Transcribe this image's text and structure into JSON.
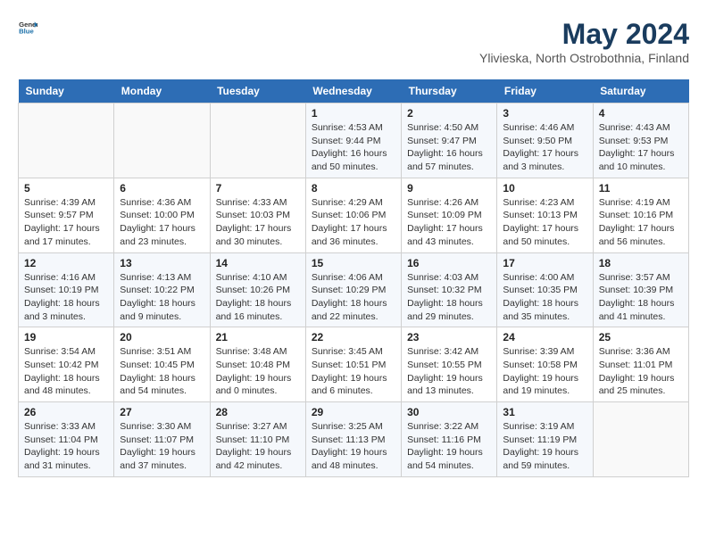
{
  "header": {
    "logo_general": "General",
    "logo_blue": "Blue",
    "month_year": "May 2024",
    "location": "Ylivieska, North Ostrobothnia, Finland"
  },
  "days_of_week": [
    "Sunday",
    "Monday",
    "Tuesday",
    "Wednesday",
    "Thursday",
    "Friday",
    "Saturday"
  ],
  "weeks": [
    [
      {
        "day": "",
        "info": ""
      },
      {
        "day": "",
        "info": ""
      },
      {
        "day": "",
        "info": ""
      },
      {
        "day": "1",
        "info": "Sunrise: 4:53 AM\nSunset: 9:44 PM\nDaylight: 16 hours\nand 50 minutes."
      },
      {
        "day": "2",
        "info": "Sunrise: 4:50 AM\nSunset: 9:47 PM\nDaylight: 16 hours\nand 57 minutes."
      },
      {
        "day": "3",
        "info": "Sunrise: 4:46 AM\nSunset: 9:50 PM\nDaylight: 17 hours\nand 3 minutes."
      },
      {
        "day": "4",
        "info": "Sunrise: 4:43 AM\nSunset: 9:53 PM\nDaylight: 17 hours\nand 10 minutes."
      }
    ],
    [
      {
        "day": "5",
        "info": "Sunrise: 4:39 AM\nSunset: 9:57 PM\nDaylight: 17 hours\nand 17 minutes."
      },
      {
        "day": "6",
        "info": "Sunrise: 4:36 AM\nSunset: 10:00 PM\nDaylight: 17 hours\nand 23 minutes."
      },
      {
        "day": "7",
        "info": "Sunrise: 4:33 AM\nSunset: 10:03 PM\nDaylight: 17 hours\nand 30 minutes."
      },
      {
        "day": "8",
        "info": "Sunrise: 4:29 AM\nSunset: 10:06 PM\nDaylight: 17 hours\nand 36 minutes."
      },
      {
        "day": "9",
        "info": "Sunrise: 4:26 AM\nSunset: 10:09 PM\nDaylight: 17 hours\nand 43 minutes."
      },
      {
        "day": "10",
        "info": "Sunrise: 4:23 AM\nSunset: 10:13 PM\nDaylight: 17 hours\nand 50 minutes."
      },
      {
        "day": "11",
        "info": "Sunrise: 4:19 AM\nSunset: 10:16 PM\nDaylight: 17 hours\nand 56 minutes."
      }
    ],
    [
      {
        "day": "12",
        "info": "Sunrise: 4:16 AM\nSunset: 10:19 PM\nDaylight: 18 hours\nand 3 minutes."
      },
      {
        "day": "13",
        "info": "Sunrise: 4:13 AM\nSunset: 10:22 PM\nDaylight: 18 hours\nand 9 minutes."
      },
      {
        "day": "14",
        "info": "Sunrise: 4:10 AM\nSunset: 10:26 PM\nDaylight: 18 hours\nand 16 minutes."
      },
      {
        "day": "15",
        "info": "Sunrise: 4:06 AM\nSunset: 10:29 PM\nDaylight: 18 hours\nand 22 minutes."
      },
      {
        "day": "16",
        "info": "Sunrise: 4:03 AM\nSunset: 10:32 PM\nDaylight: 18 hours\nand 29 minutes."
      },
      {
        "day": "17",
        "info": "Sunrise: 4:00 AM\nSunset: 10:35 PM\nDaylight: 18 hours\nand 35 minutes."
      },
      {
        "day": "18",
        "info": "Sunrise: 3:57 AM\nSunset: 10:39 PM\nDaylight: 18 hours\nand 41 minutes."
      }
    ],
    [
      {
        "day": "19",
        "info": "Sunrise: 3:54 AM\nSunset: 10:42 PM\nDaylight: 18 hours\nand 48 minutes."
      },
      {
        "day": "20",
        "info": "Sunrise: 3:51 AM\nSunset: 10:45 PM\nDaylight: 18 hours\nand 54 minutes."
      },
      {
        "day": "21",
        "info": "Sunrise: 3:48 AM\nSunset: 10:48 PM\nDaylight: 19 hours\nand 0 minutes."
      },
      {
        "day": "22",
        "info": "Sunrise: 3:45 AM\nSunset: 10:51 PM\nDaylight: 19 hours\nand 6 minutes."
      },
      {
        "day": "23",
        "info": "Sunrise: 3:42 AM\nSunset: 10:55 PM\nDaylight: 19 hours\nand 13 minutes."
      },
      {
        "day": "24",
        "info": "Sunrise: 3:39 AM\nSunset: 10:58 PM\nDaylight: 19 hours\nand 19 minutes."
      },
      {
        "day": "25",
        "info": "Sunrise: 3:36 AM\nSunset: 11:01 PM\nDaylight: 19 hours\nand 25 minutes."
      }
    ],
    [
      {
        "day": "26",
        "info": "Sunrise: 3:33 AM\nSunset: 11:04 PM\nDaylight: 19 hours\nand 31 minutes."
      },
      {
        "day": "27",
        "info": "Sunrise: 3:30 AM\nSunset: 11:07 PM\nDaylight: 19 hours\nand 37 minutes."
      },
      {
        "day": "28",
        "info": "Sunrise: 3:27 AM\nSunset: 11:10 PM\nDaylight: 19 hours\nand 42 minutes."
      },
      {
        "day": "29",
        "info": "Sunrise: 3:25 AM\nSunset: 11:13 PM\nDaylight: 19 hours\nand 48 minutes."
      },
      {
        "day": "30",
        "info": "Sunrise: 3:22 AM\nSunset: 11:16 PM\nDaylight: 19 hours\nand 54 minutes."
      },
      {
        "day": "31",
        "info": "Sunrise: 3:19 AM\nSunset: 11:19 PM\nDaylight: 19 hours\nand 59 minutes."
      },
      {
        "day": "",
        "info": ""
      }
    ]
  ]
}
